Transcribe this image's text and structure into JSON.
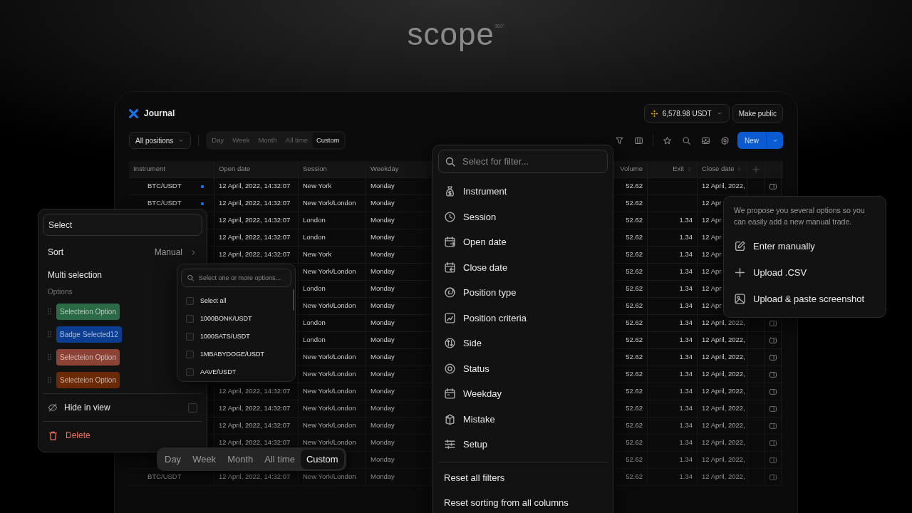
{
  "logo": {
    "name": "scope",
    "superscript": "360°"
  },
  "journal": {
    "title": "Journal",
    "balance": "6,578.98 USDT",
    "make_public": "Make public",
    "positions_filter": "All positions",
    "periods": [
      {
        "label": "Day",
        "selected": false
      },
      {
        "label": "Week",
        "selected": false
      },
      {
        "label": "Month",
        "selected": false
      },
      {
        "label": "All time",
        "selected": false
      },
      {
        "label": "Custom",
        "selected": true
      }
    ],
    "new_button": "New",
    "table": {
      "columns": [
        {
          "label": "Instrument",
          "sortable": false
        },
        {
          "label": "Open date",
          "sortable": false
        },
        {
          "label": "Session",
          "sortable": false
        },
        {
          "label": "Weekday",
          "sortable": false
        },
        {
          "label": "Volume",
          "sortable": false
        },
        {
          "label": "Exit",
          "sortable": true
        },
        {
          "label": "Close date",
          "sortable": true
        }
      ],
      "rows": [
        {
          "cells": [
            "BTC/USDT",
            "12 April, 2022, 14:32:07",
            "New York",
            "Monday",
            "52.62",
            null,
            "12 April, 2022,"
          ],
          "marked": true,
          "attachment": true
        },
        {
          "cells": [
            "BTC/USDT",
            "12 April, 2022, 14:32:07",
            "New York/London",
            "Monday",
            "52.62",
            null,
            "12 Apr"
          ],
          "marked": true
        },
        {
          "cells": [
            null,
            "12 April, 2022, 14:32:07",
            "London",
            "Monday",
            "52.62",
            "1.34",
            "12 Apr"
          ]
        },
        {
          "cells": [
            null,
            "12 April, 2022, 14:32:07",
            "London",
            "Monday",
            "52.62",
            "1.34",
            "12 Apr"
          ]
        },
        {
          "cells": [
            null,
            "12 April, 2022, 14:32:07",
            "New York",
            "Monday",
            "52.62",
            "1.34",
            "12 Apr"
          ]
        },
        {
          "cells": [
            null,
            null,
            "New York/London",
            "Monday",
            "52.62",
            "1.34",
            "12 Apr"
          ]
        },
        {
          "cells": [
            null,
            null,
            "London",
            "Monday",
            "52.62",
            "1.34",
            "12 Apr"
          ]
        },
        {
          "cells": [
            null,
            null,
            "New York/London",
            "Monday",
            "52.62",
            "1.34",
            "12 Apr"
          ]
        },
        {
          "cells": [
            null,
            null,
            "London",
            "Monday",
            "52.62",
            "1.34",
            "12 April, 2022,"
          ],
          "attachment": true
        },
        {
          "cells": [
            null,
            null,
            "London",
            "Monday",
            "52.62",
            "1.34",
            "12 April, 2022,"
          ],
          "attachment": true
        },
        {
          "cells": [
            null,
            null,
            "New York/London",
            "Monday",
            "52.62",
            "1.34",
            "12 April, 2022,"
          ],
          "attachment": true
        },
        {
          "cells": [
            null,
            null,
            "New York/London",
            "Monday",
            "52.62",
            "1.34",
            "12 April, 2022,"
          ],
          "attachment": true
        },
        {
          "cells": [
            null,
            "12 April, 2022, 14:32:07",
            "New York/London",
            "Monday",
            "52.62",
            "1.34",
            "12 April, 2022,"
          ],
          "attachment": true
        },
        {
          "cells": [
            null,
            "12 April, 2022, 14:32:07",
            "New York/London",
            "Monday",
            "52.62",
            "1.34",
            "12 April, 2022,"
          ],
          "attachment": true
        },
        {
          "cells": [
            null,
            "12 April, 2022, 14:32:07",
            "New York/London",
            "Monday",
            "52.62",
            "1.34",
            "12 April, 2022,"
          ],
          "attachment": true
        },
        {
          "cells": [
            null,
            "12 April, 2022, 14:32:07",
            "New York/London",
            "Monday",
            "52.62",
            "1.34",
            "12 April, 2022,"
          ],
          "attachment": true
        },
        {
          "cells": [
            null,
            null,
            null,
            "Monday",
            "52.62",
            "1.34",
            "12 April, 2022,"
          ],
          "attachment": true
        },
        {
          "cells": [
            "BTC/USDT",
            "12 April, 2022, 14:32:07",
            "New York/London",
            "Monday",
            "52.62",
            "1.34",
            "12 April, 2022,"
          ],
          "attachment": true
        }
      ]
    }
  },
  "property_panel": {
    "select_value": "Select",
    "sort_label": "Sort",
    "sort_value": "Manual",
    "multi_label": "Multi selection",
    "options_label": "Options",
    "options": [
      {
        "label": "Selecteion Option",
        "color": "#2a6b45"
      },
      {
        "label": "Badge Selected12",
        "color": "#0b3d91"
      },
      {
        "label": "Selecteion Option",
        "color": "#8c4234"
      },
      {
        "label": "Selecteion Option",
        "color": "#6b2a06"
      }
    ],
    "hide_label": "Hide in view",
    "hide_checked": false,
    "delete_label": "Delete"
  },
  "multi_select": {
    "placeholder": "Select one or more options...",
    "items": [
      {
        "label": "Select all",
        "checked": false
      },
      {
        "label": "1000BONK/USDT",
        "checked": false
      },
      {
        "label": "1000SATS/USDT",
        "checked": false
      },
      {
        "label": "1MBABYDOGE/USDT",
        "checked": false
      },
      {
        "label": "AAVE/USDT",
        "checked": false
      }
    ]
  },
  "filter_menu": {
    "placeholder": "Select for filter...",
    "items": [
      {
        "label": "Instrument",
        "kind": "bag"
      },
      {
        "label": "Session",
        "kind": "clock"
      },
      {
        "label": "Open date",
        "kind": "calendar-in"
      },
      {
        "label": "Close date",
        "kind": "calendar-out"
      },
      {
        "label": "Position type",
        "kind": "spiral"
      },
      {
        "label": "Position criteria",
        "kind": "chart"
      },
      {
        "label": "Side",
        "kind": "arrows"
      },
      {
        "label": "Status",
        "kind": "target"
      },
      {
        "label": "Weekday",
        "kind": "calendar"
      },
      {
        "label": "Mistake",
        "kind": "box"
      },
      {
        "label": "Setup",
        "kind": "sliders"
      }
    ],
    "actions": [
      "Reset all filters",
      "Reset sorting from all columns"
    ]
  },
  "new_trade_popover": {
    "description": "We propose you several options so you can easily add a new manual trade.",
    "items": [
      {
        "label": "Enter manually",
        "kind": "edit"
      },
      {
        "label": "Upload .CSV",
        "kind": "plus"
      },
      {
        "label": "Upload & paste screenshot",
        "kind": "image"
      }
    ]
  },
  "period_switcher": [
    {
      "label": "Day",
      "selected": false
    },
    {
      "label": "Week",
      "selected": false
    },
    {
      "label": "Month",
      "selected": false
    },
    {
      "label": "All time",
      "selected": false
    },
    {
      "label": "Custom",
      "selected": true
    }
  ]
}
